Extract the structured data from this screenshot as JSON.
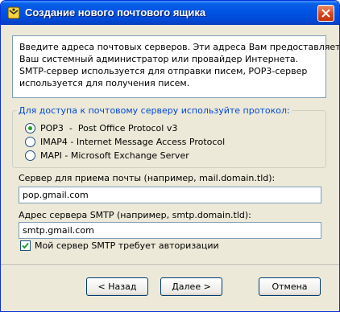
{
  "window": {
    "title": "Создание нового почтового ящика"
  },
  "info": {
    "lines": [
      "Введите адреса почтовых серверов. Эти адреса Вам предоставляет",
      "Ваш системный администратор или провайдер Интернета.",
      "SMTP-сервер используется для отправки писем, POP3-сервер",
      "используется для получения писем."
    ]
  },
  "protocol": {
    "legend": "Для доступа к почтовому серверу используйте протокол:",
    "options": [
      {
        "label": "POP3  -  Post Office Protocol v3",
        "selected": true
      },
      {
        "label": "IMAP4 - Internet Message Access Protocol",
        "selected": false
      },
      {
        "label": "MAPI - Microsoft Exchange Server",
        "selected": false
      }
    ]
  },
  "incoming": {
    "label": "Сервер для приема почты  (например, mail.domain.tld):",
    "value": "pop.gmail.com"
  },
  "outgoing": {
    "label": "Адрес сервера SMTP (например, smtp.domain.tld):",
    "value": "smtp.gmail.com"
  },
  "auth": {
    "label": "Мой сервер SMTP требует авторизации",
    "checked": true
  },
  "buttons": {
    "back": "< Назад",
    "next": "Далее >",
    "cancel": "Отмена"
  }
}
